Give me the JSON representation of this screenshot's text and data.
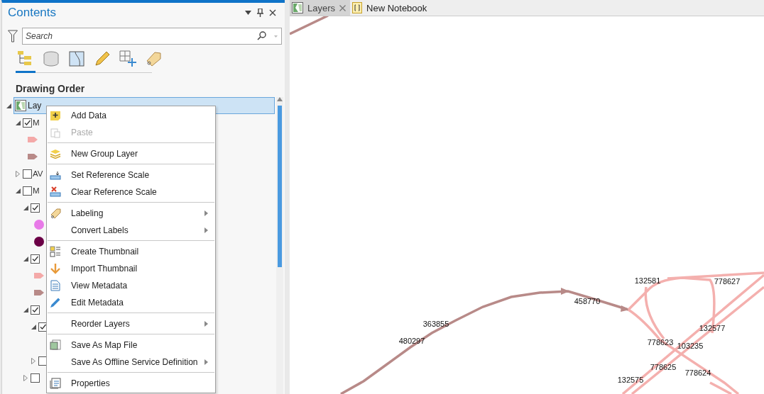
{
  "contents_panel": {
    "title": "Contents",
    "search": {
      "placeholder": "Search"
    },
    "view_tabs": [
      {
        "kind": "drawing_order",
        "selected": true
      },
      {
        "kind": "source",
        "selected": false
      },
      {
        "kind": "selection",
        "selected": false
      },
      {
        "kind": "editing",
        "selected": false
      },
      {
        "kind": "snapping",
        "selected": false
      },
      {
        "kind": "labeling",
        "selected": false
      }
    ],
    "heading": "Drawing Order",
    "tree": {
      "label": "Lay",
      "selected": true,
      "expanded": true,
      "children": [
        {
          "label": "M",
          "checked": true,
          "expanded": true,
          "symbols": [
            {
              "kind": "line",
              "color": "#f4a9a8"
            },
            {
              "kind": "line",
              "color": "#b88a88"
            }
          ]
        },
        {
          "label": "AV",
          "checked": false,
          "expanded": false
        },
        {
          "label": "M",
          "checked": false,
          "expanded": true,
          "children": [
            {
              "checked": true,
              "expanded": true,
              "symbols": [
                {
                  "kind": "point",
                  "color": "#e87ae8"
                },
                {
                  "kind": "point",
                  "color": "#6b0046"
                }
              ]
            },
            {
              "checked": true,
              "expanded": true,
              "symbols": [
                {
                  "kind": "line",
                  "color": "#f4a9a8"
                },
                {
                  "kind": "line",
                  "color": "#b88a88"
                }
              ]
            },
            {
              "checked": true,
              "expanded": true,
              "children": [
                {
                  "checked": true,
                  "expanded": true,
                  "symbols": [
                    {
                      "kind": "blank"
                    }
                  ]
                },
                {
                  "checked": false,
                  "expanded": false
                }
              ]
            },
            {
              "checked": false,
              "expanded": false
            }
          ]
        }
      ]
    }
  },
  "context_menu": [
    {
      "kind": "item",
      "label": "Add Data",
      "disabled": false,
      "submenu": false
    },
    {
      "kind": "item",
      "label": "Paste",
      "disabled": true,
      "submenu": false
    },
    {
      "kind": "separator"
    },
    {
      "kind": "item",
      "label": "New Group Layer",
      "disabled": false,
      "submenu": false
    },
    {
      "kind": "separator"
    },
    {
      "kind": "item",
      "label": "Set Reference Scale",
      "disabled": false,
      "submenu": false
    },
    {
      "kind": "item",
      "label": "Clear Reference Scale",
      "disabled": false,
      "submenu": false
    },
    {
      "kind": "separator"
    },
    {
      "kind": "item",
      "label": "Labeling",
      "disabled": false,
      "submenu": true
    },
    {
      "kind": "item",
      "label": "Convert Labels",
      "disabled": false,
      "submenu": true
    },
    {
      "kind": "separator"
    },
    {
      "kind": "item",
      "label": "Create Thumbnail",
      "disabled": false,
      "submenu": false
    },
    {
      "kind": "item",
      "label": "Import Thumbnail",
      "disabled": false,
      "submenu": false
    },
    {
      "kind": "item",
      "label": "View Metadata",
      "disabled": false,
      "submenu": false
    },
    {
      "kind": "item",
      "label": "Edit Metadata",
      "disabled": false,
      "submenu": false
    },
    {
      "kind": "separator"
    },
    {
      "kind": "item",
      "label": "Reorder Layers",
      "disabled": false,
      "submenu": true
    },
    {
      "kind": "separator"
    },
    {
      "kind": "item",
      "label": "Save As Map File",
      "disabled": false,
      "submenu": false
    },
    {
      "kind": "item",
      "label": "Save As Offline Service Definition",
      "disabled": false,
      "submenu": true
    },
    {
      "kind": "separator"
    },
    {
      "kind": "item",
      "label": "Properties",
      "disabled": false,
      "submenu": false
    }
  ],
  "document_tabs": [
    {
      "kind": "map",
      "label": "Layers",
      "selected": true,
      "closable": true
    },
    {
      "kind": "notebook",
      "label": "New Notebook",
      "selected": false,
      "closable": false
    }
  ],
  "map_labels": [
    "132581",
    "778627",
    "458770",
    "363855",
    "132577",
    "480297",
    "778623",
    "103235",
    "778625",
    "778624",
    "132575"
  ]
}
